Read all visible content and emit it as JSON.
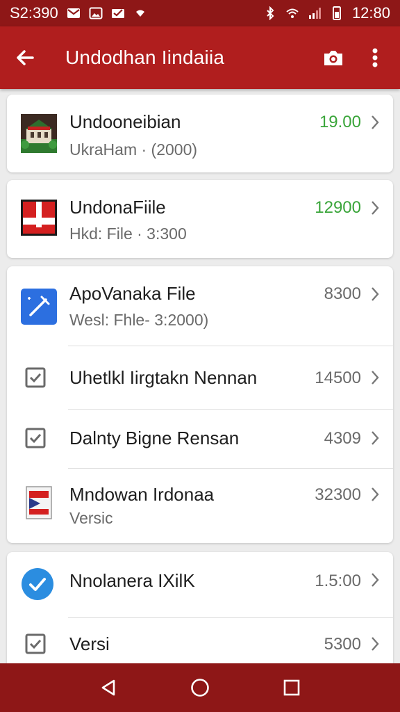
{
  "status_bar": {
    "time_left": "S2:390",
    "time_right": "12:80"
  },
  "app_bar": {
    "title": "Undodhan Iindaiia"
  },
  "items": [
    {
      "title": "Undooneibian",
      "subtitle": "UkraHam · (2000)",
      "value": "19.00",
      "value_color": "#3aa53a",
      "icon": "building-thumbnail-icon"
    },
    {
      "title": "UndonaFiile",
      "subtitle": "Hkd: File · 3:300",
      "value": "12900",
      "value_color": "#3aa53a",
      "icon": "red-flag-thumbnail-icon"
    },
    {
      "title": "ApoVanaka File",
      "subtitle": "Wesl: Fhle- 3:2000)",
      "value": "8300",
      "icon": "blue-tool-app-icon"
    },
    {
      "title": "Uhetlkl Iirgtakn Nennan",
      "subtitle": "",
      "value": "14500",
      "icon": "checkbox-icon"
    },
    {
      "title": "Dalnty Bigne Rensan",
      "subtitle": "",
      "value": "4309",
      "icon": "checkbox-icon"
    },
    {
      "title": "Mndowan Irdonaa",
      "subtitle": "Versic",
      "value": "32300",
      "icon": "flag-document-icon"
    },
    {
      "title": "Nnolanera IXilK",
      "subtitle": "",
      "value": "1.5:00",
      "icon": "blue-check-circle-icon"
    },
    {
      "title": "Versi",
      "subtitle": "",
      "value": "5300",
      "icon": "checkbox-icon"
    }
  ],
  "colors": {
    "primary": "#b01e1e",
    "primary_dark": "#8e1717",
    "accent_green": "#3aa53a"
  }
}
